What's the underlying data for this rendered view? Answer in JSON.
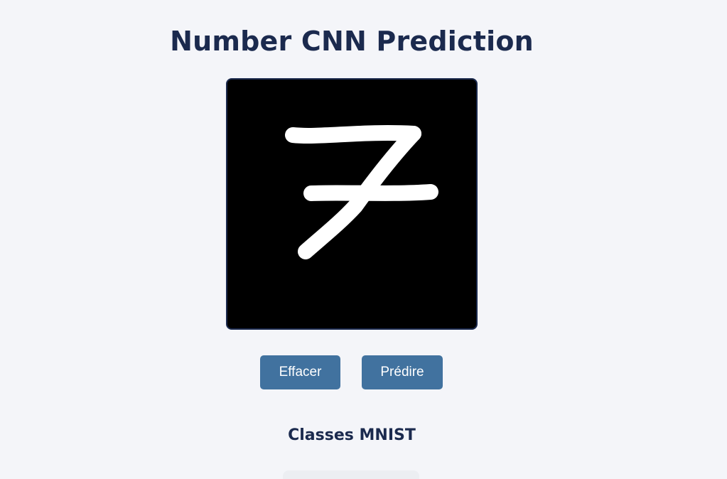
{
  "header": {
    "title": "Number CNN Prediction"
  },
  "canvas": {
    "drawn_digit": "7"
  },
  "buttons": {
    "clear_label": "Effacer",
    "predict_label": "Prédire"
  },
  "classes": {
    "title": "Classes MNIST"
  },
  "colors": {
    "background": "#f4f5f9",
    "title": "#1b2a4e",
    "button": "#41729f",
    "canvas_bg": "#000000",
    "stroke": "#ffffff"
  }
}
